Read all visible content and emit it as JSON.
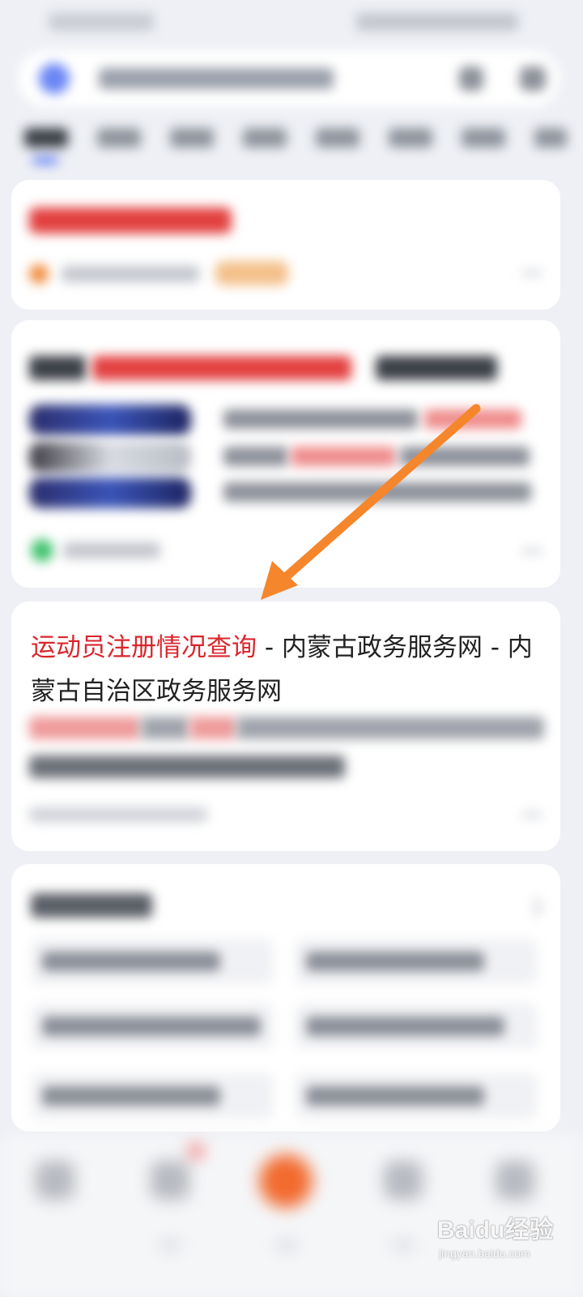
{
  "result": {
    "title_highlight": "运动员注册情况查询",
    "title_rest": " - 内蒙古政务服务网 - 内蒙古自治区政务服务网"
  },
  "annotation": {
    "arrow_color": "#f5862b"
  },
  "watermark": {
    "brand": "Baidu经验",
    "url": "jingyan.baidu.com"
  },
  "colors": {
    "highlight": "#d9262c",
    "title_text": "#222222",
    "accent_tab": "#4e6ef2",
    "center_nav": "#f26b2f"
  }
}
